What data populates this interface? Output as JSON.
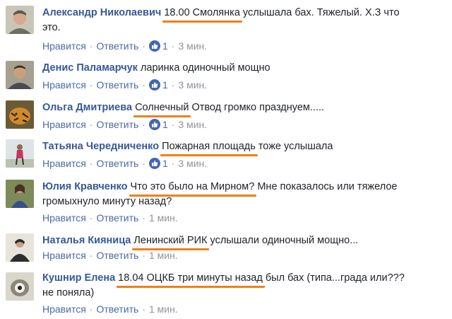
{
  "labels": {
    "like": "Нравится",
    "reply": "Ответить",
    "sep": "·"
  },
  "colors": {
    "name": "#365899",
    "link": "#4b6aa7",
    "meta": "#90949c",
    "underline": "#f07f1a",
    "like_badge": "#4267b2"
  },
  "comments": [
    {
      "author": "Александр Николаевич",
      "hl": "18.00 Смолянка",
      "text": " услышала бах. Тяжелый. Х.З что",
      "text2": "это.",
      "likes": "1",
      "time": "3 мин."
    },
    {
      "author": "Денис Паламарчук",
      "text": "ларинка одиночный мощно",
      "likes": "1",
      "time": "3 мин."
    },
    {
      "author": "Ольга Дмитриева",
      "hl": "Солнечный",
      "text": " Отвод громко празднуем.....",
      "likes": "1",
      "time": "3 мин."
    },
    {
      "author": "Татьяна Чередниченко",
      "hl": "Пожарная площадь",
      "text": " тоже услышала",
      "likes": "1",
      "time": "3 мин."
    },
    {
      "author": "Юлия Кравченко",
      "hl": "Что это было на Мирном?",
      "text": " Мне показалось или тяжелое",
      "text2": "громыхнуло минуту назад?",
      "time": "1 мин."
    },
    {
      "author": "Наталья Кияница",
      "hl": "Ленинский РИК",
      "text": " услышали одиночный мощно...",
      "time": "1 мин."
    },
    {
      "author": "Кушнир Елена",
      "hl": "18.04 ОЦКБ три минуты назад",
      "text": " был бах (типа...града или???",
      "text2": "не поняла)",
      "time": "1 мин."
    }
  ]
}
